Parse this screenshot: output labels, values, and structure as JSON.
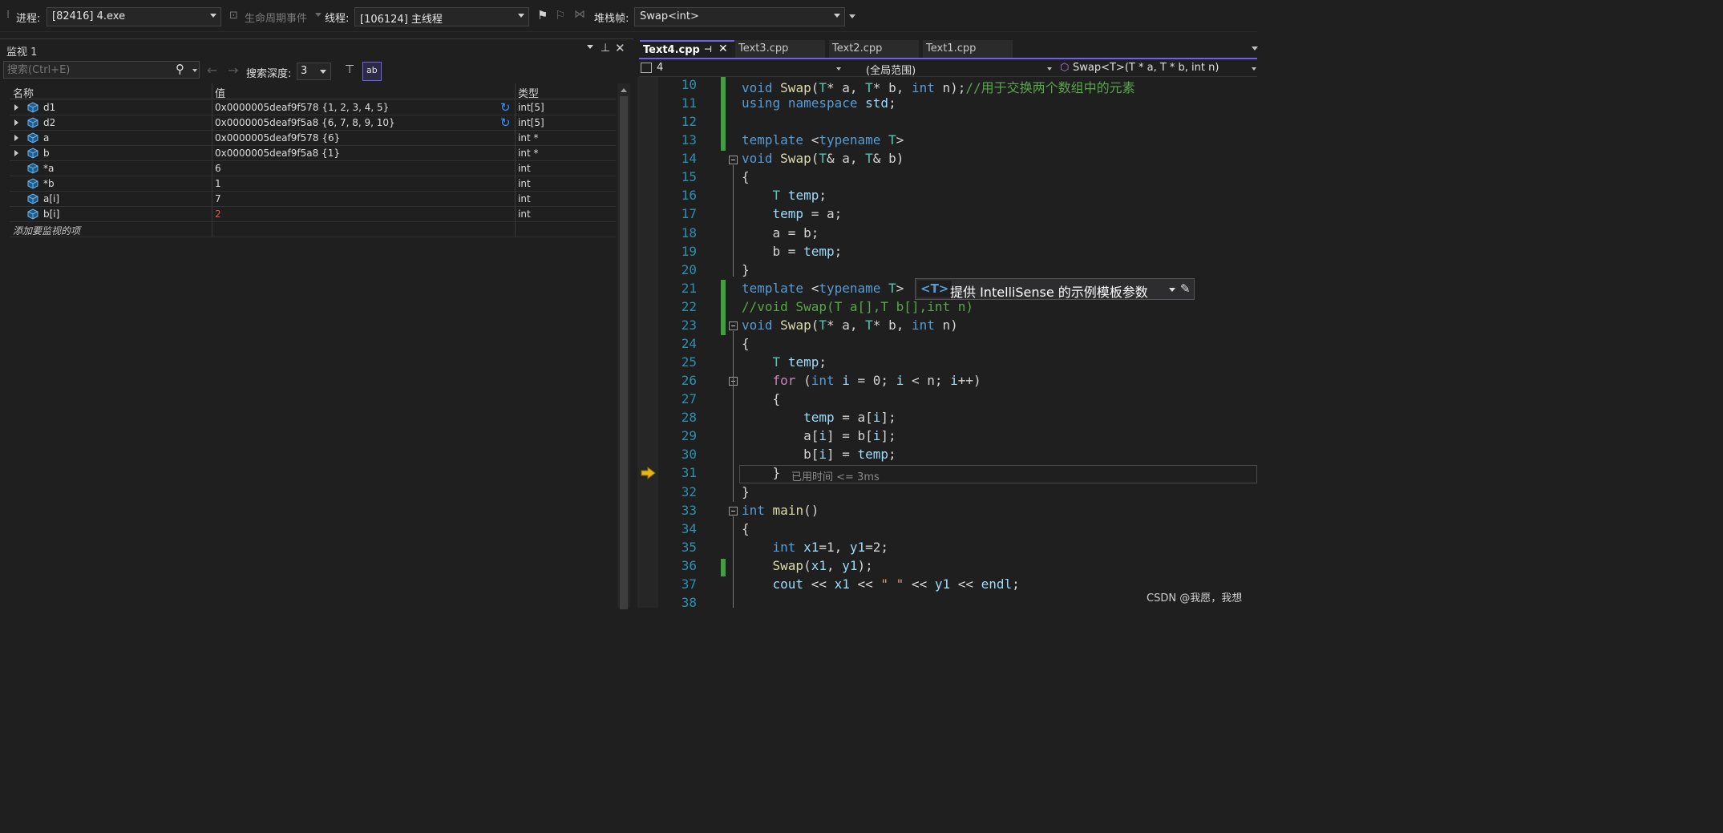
{
  "toolbar": {
    "process_label": "进程:",
    "process_value": "[82416] 4.exe",
    "lifecycle_label": "生命周期事件",
    "thread_label": "线程:",
    "thread_value": "[106124] 主线程",
    "stackframe_label": "堆栈帧:",
    "stackframe_value": "Swap<int>"
  },
  "watch": {
    "title": "监视 1",
    "search_placeholder": "搜索(Ctrl+E)",
    "search_depth_label": "搜索深度:",
    "search_depth_value": "3",
    "columns": [
      "名称",
      "值",
      "类型"
    ],
    "rows": [
      {
        "name": "d1",
        "value": "0x0000005deaf9f578 {1, 2, 3, 4, 5}",
        "type": "int[5]",
        "expandable": true,
        "refresh": true
      },
      {
        "name": "d2",
        "value": "0x0000005deaf9f5a8 {6, 7, 8, 9, 10}",
        "type": "int[5]",
        "expandable": true,
        "refresh": true
      },
      {
        "name": "a",
        "value": "0x0000005deaf9f578 {6}",
        "type": "int *",
        "expandable": true,
        "refresh": false
      },
      {
        "name": "b",
        "value": "0x0000005deaf9f5a8 {1}",
        "type": "int *",
        "expandable": true,
        "refresh": false
      },
      {
        "name": "*a",
        "value": "6",
        "type": "int",
        "expandable": false,
        "refresh": false
      },
      {
        "name": "*b",
        "value": "1",
        "type": "int",
        "expandable": false,
        "refresh": false
      },
      {
        "name": "a[i]",
        "value": "7",
        "type": "int",
        "expandable": false,
        "refresh": false
      },
      {
        "name": "b[i]",
        "value": "2",
        "type": "int",
        "expandable": false,
        "refresh": false,
        "changed": true
      }
    ],
    "add_item_text": "添加要监视的项"
  },
  "editor": {
    "tabs": [
      {
        "label": "Text4.cpp",
        "active": true
      },
      {
        "label": "Text3.cpp",
        "active": false
      },
      {
        "label": "Text2.cpp",
        "active": false
      },
      {
        "label": "Text1.cpp",
        "active": false
      }
    ],
    "nav_project": "4",
    "nav_scope": "(全局范围)",
    "nav_member": "Swap<T>(T * a, T * b, int n)",
    "intellisense_badge": "<T>",
    "intellisense_text": "提供 IntelliSense 的示例模板参数",
    "elapsed_hint": "已用时间 <= 3ms",
    "lines": [
      {
        "n": "10",
        "text": "void Swap(T* a, T* b, int n);//用于交换两个数组中的元素"
      },
      {
        "n": "11",
        "text": "using namespace std;"
      },
      {
        "n": "12",
        "text": ""
      },
      {
        "n": "13",
        "text": "template <typename T>"
      },
      {
        "n": "14",
        "text": "void Swap(T& a, T& b)"
      },
      {
        "n": "15",
        "text": "{"
      },
      {
        "n": "16",
        "text": "    T temp;"
      },
      {
        "n": "17",
        "text": "    temp = a;"
      },
      {
        "n": "18",
        "text": "    a = b;"
      },
      {
        "n": "19",
        "text": "    b = temp;"
      },
      {
        "n": "20",
        "text": "}"
      },
      {
        "n": "21",
        "text": "template <typename T>"
      },
      {
        "n": "22",
        "text": "//void Swap(T a[],T b[],int n)"
      },
      {
        "n": "23",
        "text": "void Swap(T* a, T* b, int n)"
      },
      {
        "n": "24",
        "text": "{"
      },
      {
        "n": "25",
        "text": "    T temp;"
      },
      {
        "n": "26",
        "text": "    for (int i = 0; i < n; i++)"
      },
      {
        "n": "27",
        "text": "    {"
      },
      {
        "n": "28",
        "text": "        temp = a[i];"
      },
      {
        "n": "29",
        "text": "        a[i] = b[i];"
      },
      {
        "n": "30",
        "text": "        b[i] = temp;"
      },
      {
        "n": "31",
        "text": "    }"
      },
      {
        "n": "32",
        "text": "}"
      },
      {
        "n": "33",
        "text": "int main()"
      },
      {
        "n": "34",
        "text": "{"
      },
      {
        "n": "35",
        "text": "    int x1=1, y1=2;"
      },
      {
        "n": "36",
        "text": "    Swap(x1, y1);"
      },
      {
        "n": "37",
        "text": "    cout << x1 << \" \" << y1 << endl;"
      },
      {
        "n": "38",
        "text": ""
      }
    ]
  },
  "watermark": "CSDN @我愿，我想",
  "colors": {
    "accent": "#7160e8",
    "keyword": "#569cd6",
    "type": "#4ec9b0",
    "comment": "#57a64a",
    "changed_value": "#f14c4c",
    "modified_bar": "#3fa03f"
  }
}
